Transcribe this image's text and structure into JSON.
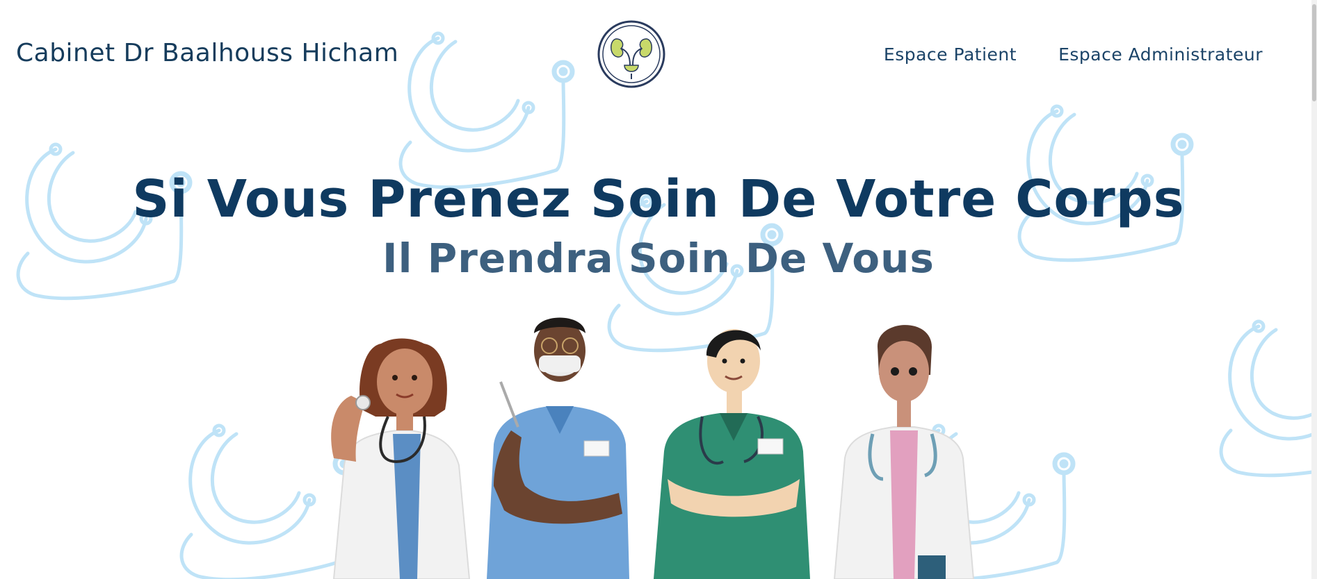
{
  "header": {
    "site_title": "Cabinet Dr Baalhouss Hicham",
    "logo_icon": "kidney-urology-logo-icon",
    "nav": [
      {
        "label": "Espace Patient"
      },
      {
        "label": "Espace Administrateur"
      }
    ]
  },
  "hero": {
    "title": "Si Vous Prenez Soin De Votre Corps",
    "subtitle": "Il Prendra Soin De Vous"
  },
  "background_icon": "stethoscope-icon",
  "colors": {
    "primary": "#0f3a60",
    "secondary": "#3d607f",
    "decor": "#bfe3f7"
  }
}
